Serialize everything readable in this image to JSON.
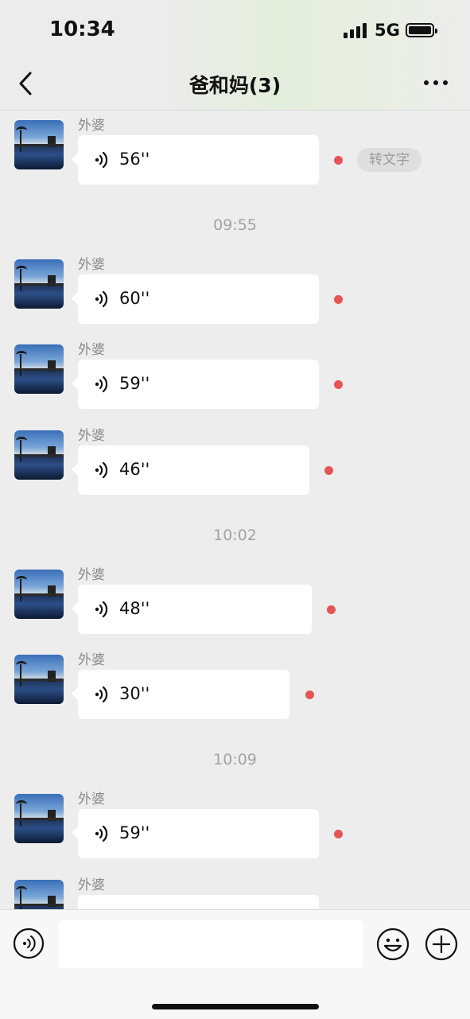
{
  "status_bar": {
    "time": "10:34",
    "network": "5G"
  },
  "header": {
    "title": "爸和妈(3)"
  },
  "messages": [
    {
      "sender": "外婆",
      "duration": "56''",
      "convert_label": "转文字"
    },
    {
      "timestamp": "09:55"
    },
    {
      "sender": "外婆",
      "duration": "60''"
    },
    {
      "sender": "外婆",
      "duration": "59''"
    },
    {
      "sender": "外婆",
      "duration": "46''"
    },
    {
      "timestamp": "10:02"
    },
    {
      "sender": "外婆",
      "duration": "48''"
    },
    {
      "sender": "外婆",
      "duration": "30''"
    },
    {
      "timestamp": "10:09"
    },
    {
      "sender": "外婆",
      "duration": "59''"
    },
    {
      "sender": "外婆",
      "duration": ""
    }
  ],
  "input": {
    "placeholder": ""
  },
  "colors": {
    "unread_dot": "#e55555",
    "background": "#ededed"
  }
}
